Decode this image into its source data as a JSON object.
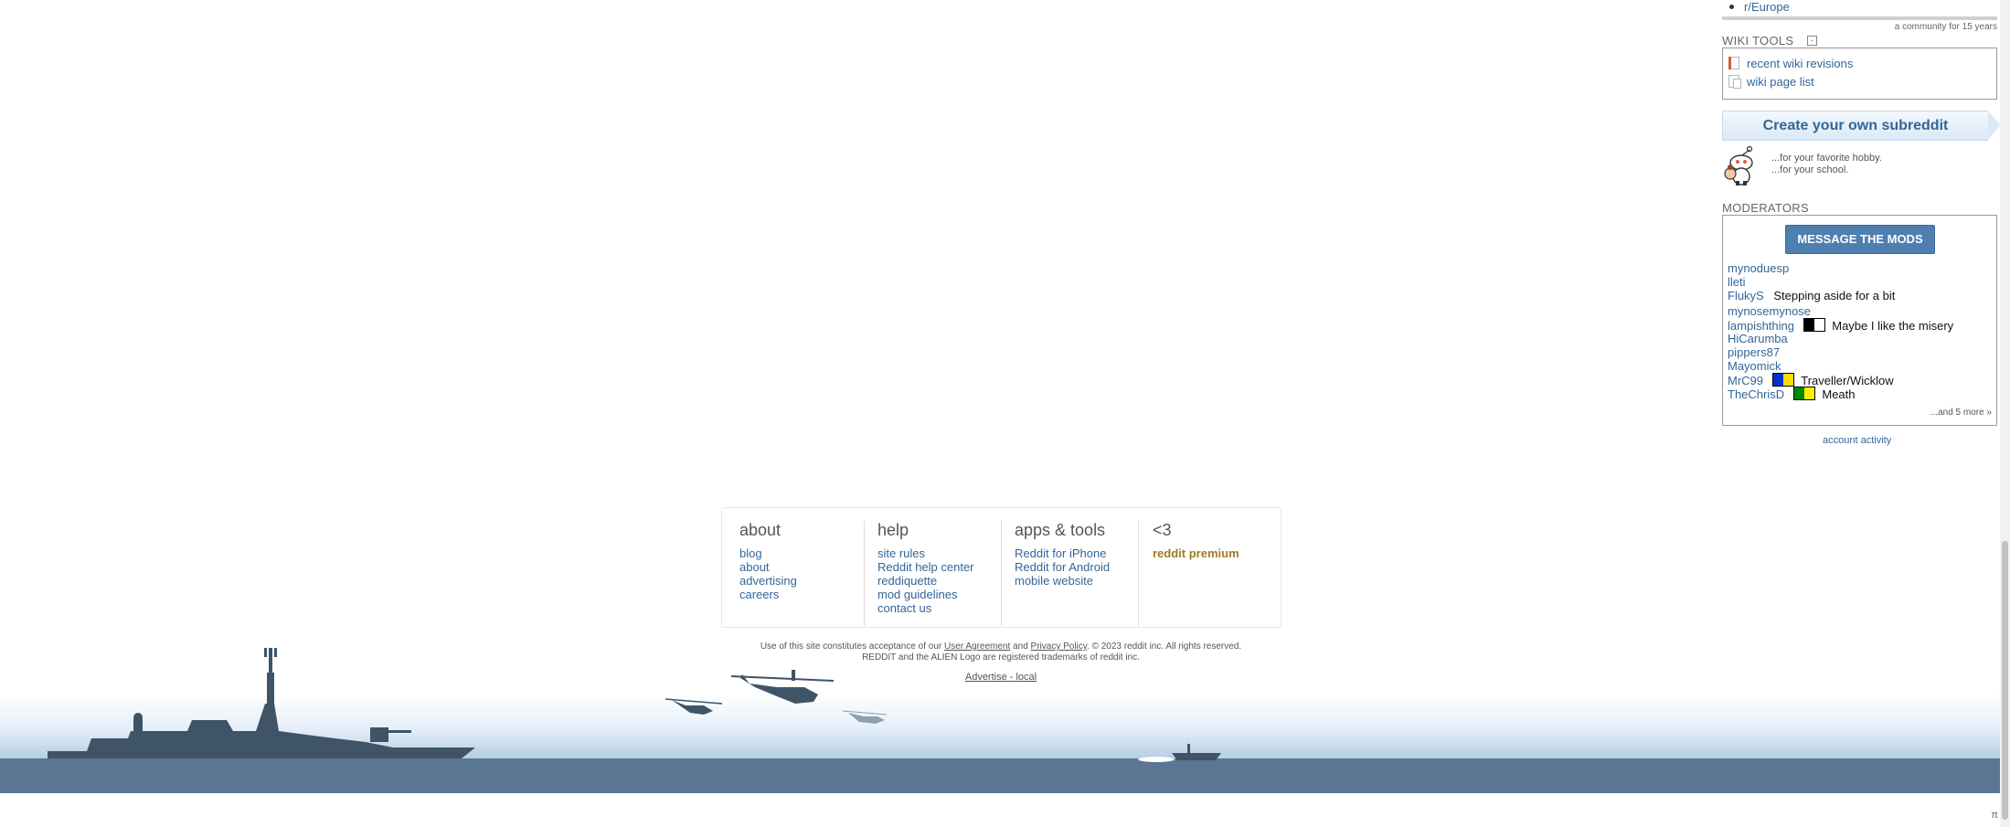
{
  "sidebar": {
    "related_link": "r/Europe",
    "community_age": "a community for 15 years",
    "wiki": {
      "title": "WIKI TOOLS",
      "collapse_symbol": "-",
      "links": [
        {
          "label": "recent wiki revisions",
          "icon": "wiki-revisions-icon"
        },
        {
          "label": "wiki page list",
          "icon": "wiki-page-list-icon"
        }
      ]
    },
    "create": {
      "button_label": "Create your own subreddit",
      "line1": "...for your favorite hobby.",
      "line2": "...for your school."
    },
    "moderators": {
      "title": "MODERATORS",
      "message_button": "MESSAGE THE MODS",
      "list": [
        {
          "name": "mynoduesp",
          "flair": ""
        },
        {
          "name": "lleti",
          "flair": ""
        },
        {
          "name": "FlukyS",
          "flair": "Stepping aside for a bit"
        },
        {
          "name": "mynosemynose",
          "flair": ""
        },
        {
          "name": "lampishthing",
          "flair": "Maybe I like the misery",
          "flair_colors": [
            "#000000",
            "#ffffff"
          ]
        },
        {
          "name": "HiCarumba",
          "flair": ""
        },
        {
          "name": "pippers87",
          "flair": ""
        },
        {
          "name": "Mayomick",
          "flair": ""
        },
        {
          "name": "MrC99",
          "flair": "Traveller/Wicklow",
          "flair_colors": [
            "#0033cc",
            "#ffdd00"
          ]
        },
        {
          "name": "TheChrisD",
          "flair": "Meath",
          "flair_colors": [
            "#008800",
            "#ffee00"
          ]
        }
      ],
      "more": "...and 5 more »"
    },
    "account_activity": "account activity"
  },
  "footer": {
    "columns": [
      {
        "heading": "about",
        "links": [
          "blog",
          "about",
          "advertising",
          "careers"
        ]
      },
      {
        "heading": "help",
        "links": [
          "site rules",
          "Reddit help center",
          "reddiquette",
          "mod guidelines",
          "contact us"
        ]
      },
      {
        "heading": "apps & tools",
        "links": [
          "Reddit for iPhone",
          "Reddit for Android",
          "mobile website"
        ]
      },
      {
        "heading": "<3",
        "links": [
          "reddit premium"
        ]
      }
    ],
    "legal": {
      "prefix": "Use of this site constitutes acceptance of our",
      "user_agreement": "User Agreement",
      "and": "and",
      "privacy": "Privacy Policy",
      "suffix": ". © 2023 reddit inc. All rights reserved.",
      "line2": "REDDIT and the ALIEN Logo are registered trademarks of reddit inc."
    },
    "advertise": "Advertise - local",
    "back_to_top": "π"
  },
  "colors": {
    "link": "#336699",
    "premium": "#a07a22",
    "mod_button": "#4f7fb0",
    "water": "#5b7693",
    "silhouette": "#3f5466"
  }
}
